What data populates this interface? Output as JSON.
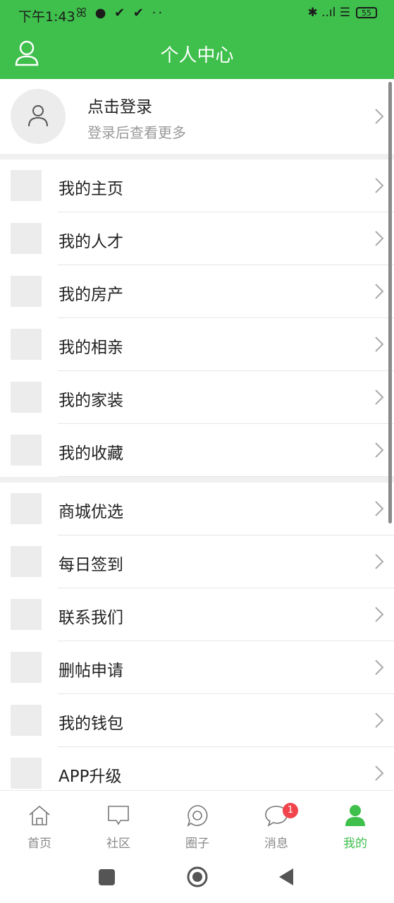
{
  "status": {
    "time": "下午1:43",
    "battery": "55",
    "notifications": "ꕤ ● ✔ ✔ ··",
    "signal": "✱ ..ıl ☰"
  },
  "header": {
    "title": "个人中心"
  },
  "login": {
    "title": "点击登录",
    "subtitle": "登录后查看更多"
  },
  "menu_group1": [
    "我的主页",
    "我的人才",
    "我的房产",
    "我的相亲",
    "我的家装",
    "我的收藏"
  ],
  "menu_group2": [
    "商城优选",
    "每日签到",
    "联系我们",
    "删帖申请",
    "我的钱包",
    "APP升级"
  ],
  "tabs": [
    {
      "label": "首页",
      "icon": "home-icon"
    },
    {
      "label": "社区",
      "icon": "community-icon"
    },
    {
      "label": "圈子",
      "icon": "circle-icon"
    },
    {
      "label": "消息",
      "icon": "message-icon",
      "badge": "1"
    },
    {
      "label": "我的",
      "icon": "user-icon",
      "active": true
    }
  ],
  "colors": {
    "primary": "#3fbf4c",
    "badge": "#f2444d"
  }
}
